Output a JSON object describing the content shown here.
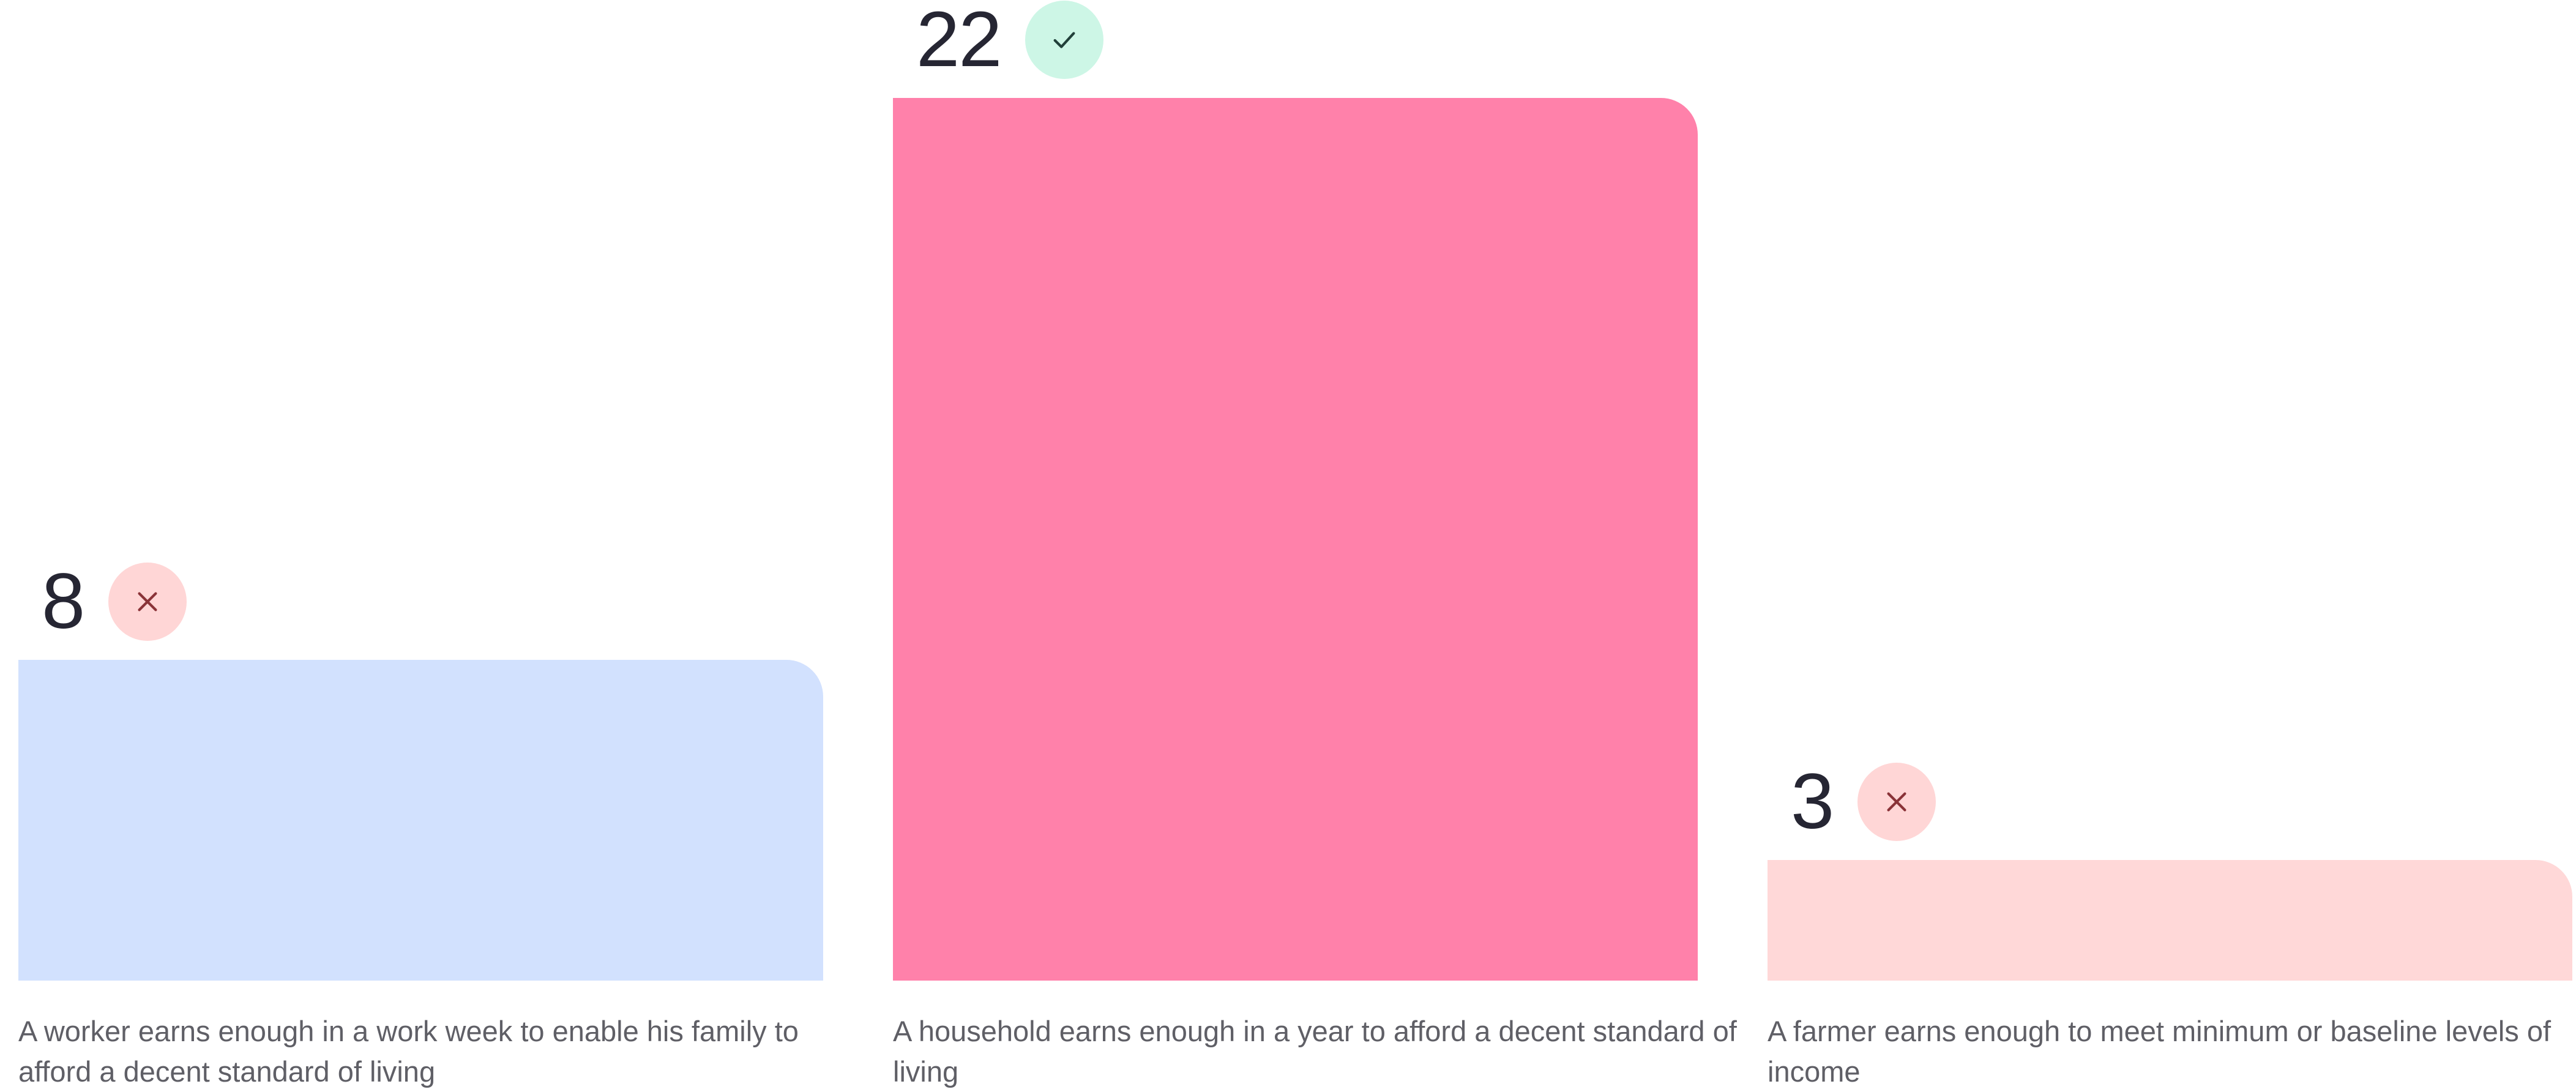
{
  "chart_data": {
    "type": "bar",
    "categories": [
      "A worker earns enough in a work week to enable his family to afford a decent standard of living",
      "A household earns enough in a year to afford a decent standard of living",
      "A farmer earns enough to meet minimum or baseline levels of income"
    ],
    "values": [
      8,
      22,
      3
    ],
    "value_labels": [
      "8",
      "22",
      "3"
    ],
    "status": [
      "cross",
      "check",
      "cross"
    ],
    "bar_colors": [
      "#d2e1fe",
      "#ff81aa",
      "#ffd8d8"
    ],
    "badge_colors": [
      "#ffd6d6",
      "#cdf6e6",
      "#ffd6d6"
    ],
    "icon_colors": [
      "#8a3338",
      "#21403a",
      "#8a3338"
    ],
    "icons": [
      "close-icon",
      "check-icon",
      "close-icon"
    ],
    "ylim": [
      0,
      22
    ],
    "grid": false,
    "legend": "none"
  }
}
